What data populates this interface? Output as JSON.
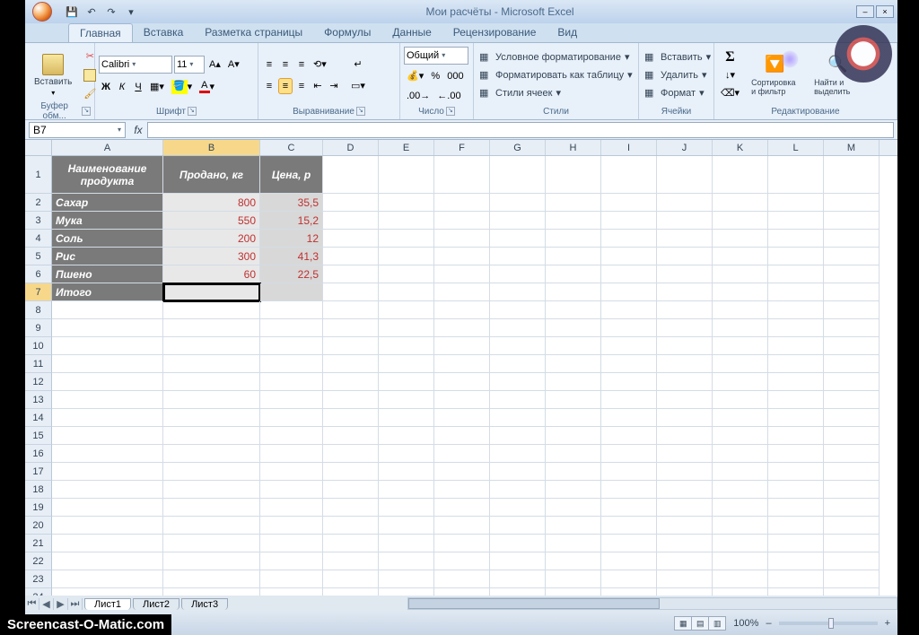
{
  "title": "Мои расчёты - Microsoft Excel",
  "qat": {
    "save": "💾",
    "undo": "↶",
    "redo": "↷"
  },
  "tabs": [
    "Главная",
    "Вставка",
    "Разметка страницы",
    "Формулы",
    "Данные",
    "Рецензирование",
    "Вид"
  ],
  "active_tab": 0,
  "ribbon": {
    "clipboard": {
      "label": "Буфер обм...",
      "paste": "Вставить"
    },
    "font": {
      "label": "Шрифт",
      "name": "Calibri",
      "size": "11",
      "bold": "Ж",
      "italic": "К",
      "underline": "Ч"
    },
    "align": {
      "label": "Выравнивание"
    },
    "number": {
      "label": "Число",
      "format": "Общий"
    },
    "styles": {
      "label": "Стили",
      "cond": "Условное форматирование",
      "table": "Форматировать как таблицу",
      "cell": "Стили ячеек"
    },
    "cells": {
      "label": "Ячейки",
      "insert": "Вставить",
      "delete": "Удалить",
      "format": "Формат"
    },
    "editing": {
      "label": "Редактирование",
      "sort": "Сортировка и фильтр",
      "find": "Найти и выделить",
      "sigma": "Σ"
    }
  },
  "namebox": "B7",
  "formula": "",
  "columns": [
    "A",
    "B",
    "C",
    "D",
    "E",
    "F",
    "G",
    "H",
    "I",
    "J",
    "K",
    "L",
    "M"
  ],
  "colwidths": [
    "wA",
    "wB",
    "wC",
    "wD",
    "wE",
    "wF",
    "wG",
    "wH",
    "wI",
    "wJ",
    "wK",
    "wL",
    "wM"
  ],
  "selected_col": 1,
  "selected_row": 7,
  "header_row": [
    "Наименование продукта",
    "Продано, кг",
    "Цена, р"
  ],
  "data_rows": [
    {
      "name": "Сахар",
      "qty": "800",
      "price": "35,5"
    },
    {
      "name": "Мука",
      "qty": "550",
      "price": "15,2"
    },
    {
      "name": "Соль",
      "qty": "200",
      "price": "12"
    },
    {
      "name": "Рис",
      "qty": "300",
      "price": "41,3"
    },
    {
      "name": "Пшено",
      "qty": "60",
      "price": "22,5"
    }
  ],
  "total_label": "Итого",
  "sheets": [
    "Лист1",
    "Лист2",
    "Лист3"
  ],
  "zoom": "100%",
  "watermark": "Screencast-O-Matic.com"
}
